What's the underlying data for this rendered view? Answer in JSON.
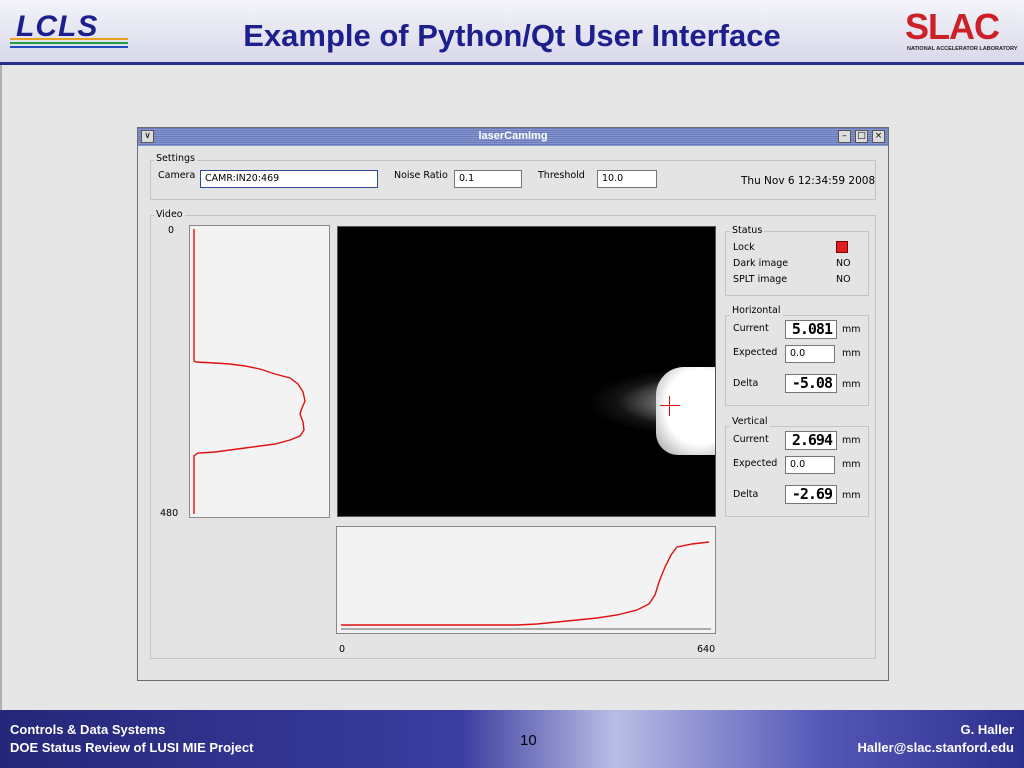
{
  "slide": {
    "title": "Example of Python/Qt User Interface",
    "logo_left": "LCLS",
    "logo_right": "SLAC",
    "logo_right_sub": "NATIONAL ACCELERATOR LABORATORY",
    "page_number": "10"
  },
  "footer": {
    "left_line1": "Controls & Data Systems",
    "left_line2": "DOE Status Review of LUSI MIE Project",
    "right_line1": "G. Haller",
    "right_line2": "Haller@slac.stanford.edu"
  },
  "window": {
    "title": "laserCamImg",
    "controls": {
      "menu": "∨",
      "minimize": "–",
      "maximize": "□",
      "close": "×"
    }
  },
  "settings": {
    "group_label": "Settings",
    "camera_label": "Camera",
    "camera_value": "CAMR:IN20:469",
    "noise_label": "Noise Ratio",
    "noise_value": "0.1",
    "threshold_label": "Threshold",
    "threshold_value": "10.0",
    "timestamp": "Thu Nov  6 12:34:59 2008"
  },
  "video": {
    "group_label": "Video",
    "v_axis_top": "0",
    "v_axis_bottom": "480",
    "h_axis_left": "0",
    "h_axis_right": "640"
  },
  "status": {
    "group_label": "Status",
    "lock_label": "Lock",
    "dark_label": "Dark image",
    "dark_value": "NO",
    "splt_label": "SPLT image",
    "splt_value": "NO",
    "lock_color": "#e02020"
  },
  "horizontal": {
    "group_label": "Horizontal",
    "current_label": "Current",
    "current_value": "5.081",
    "expected_label": "Expected",
    "expected_value": "0.0",
    "delta_label": "Delta",
    "delta_value": "-5.08",
    "unit": "mm"
  },
  "vertical": {
    "group_label": "Vertical",
    "current_label": "Current",
    "current_value": "2.694",
    "expected_label": "Expected",
    "expected_value": "0.0",
    "delta_label": "Delta",
    "delta_value": "-2.69",
    "unit": "mm"
  },
  "colors": {
    "header_text": "#1c1f8c",
    "profile_line": "#e01010",
    "slac_red": "#cc1f26"
  }
}
